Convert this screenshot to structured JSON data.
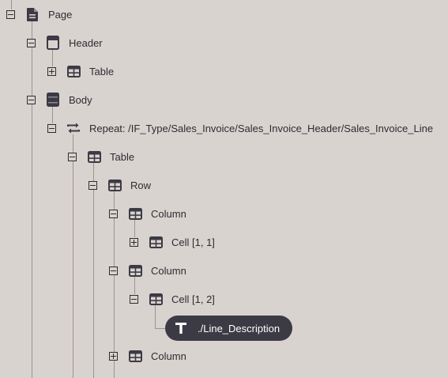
{
  "tree": {
    "page": {
      "label": "Page",
      "icon": "document-icon"
    },
    "header": {
      "label": "Header",
      "icon": "header-layout-icon"
    },
    "header_table": {
      "label": "Table",
      "icon": "table-icon"
    },
    "body": {
      "label": "Body",
      "icon": "body-layout-icon"
    },
    "repeat": {
      "label": "Repeat: /IF_Type/Sales_Invoice/Sales_Invoice_Header/Sales_Invoice_Line",
      "icon": "repeat-icon"
    },
    "body_table": {
      "label": "Table",
      "icon": "table-icon"
    },
    "row": {
      "label": "Row",
      "icon": "table-icon"
    },
    "column1": {
      "label": "Column",
      "icon": "table-icon"
    },
    "cell_1_1": {
      "label": "Cell [1, 1]",
      "icon": "table-icon"
    },
    "column2": {
      "label": "Column",
      "icon": "table-icon"
    },
    "cell_1_2": {
      "label": "Cell [1, 2]",
      "icon": "table-icon"
    },
    "line_description": {
      "label": "./Line_Description",
      "icon": "text-icon"
    },
    "column3": {
      "label": "Column",
      "icon": "table-icon"
    }
  }
}
